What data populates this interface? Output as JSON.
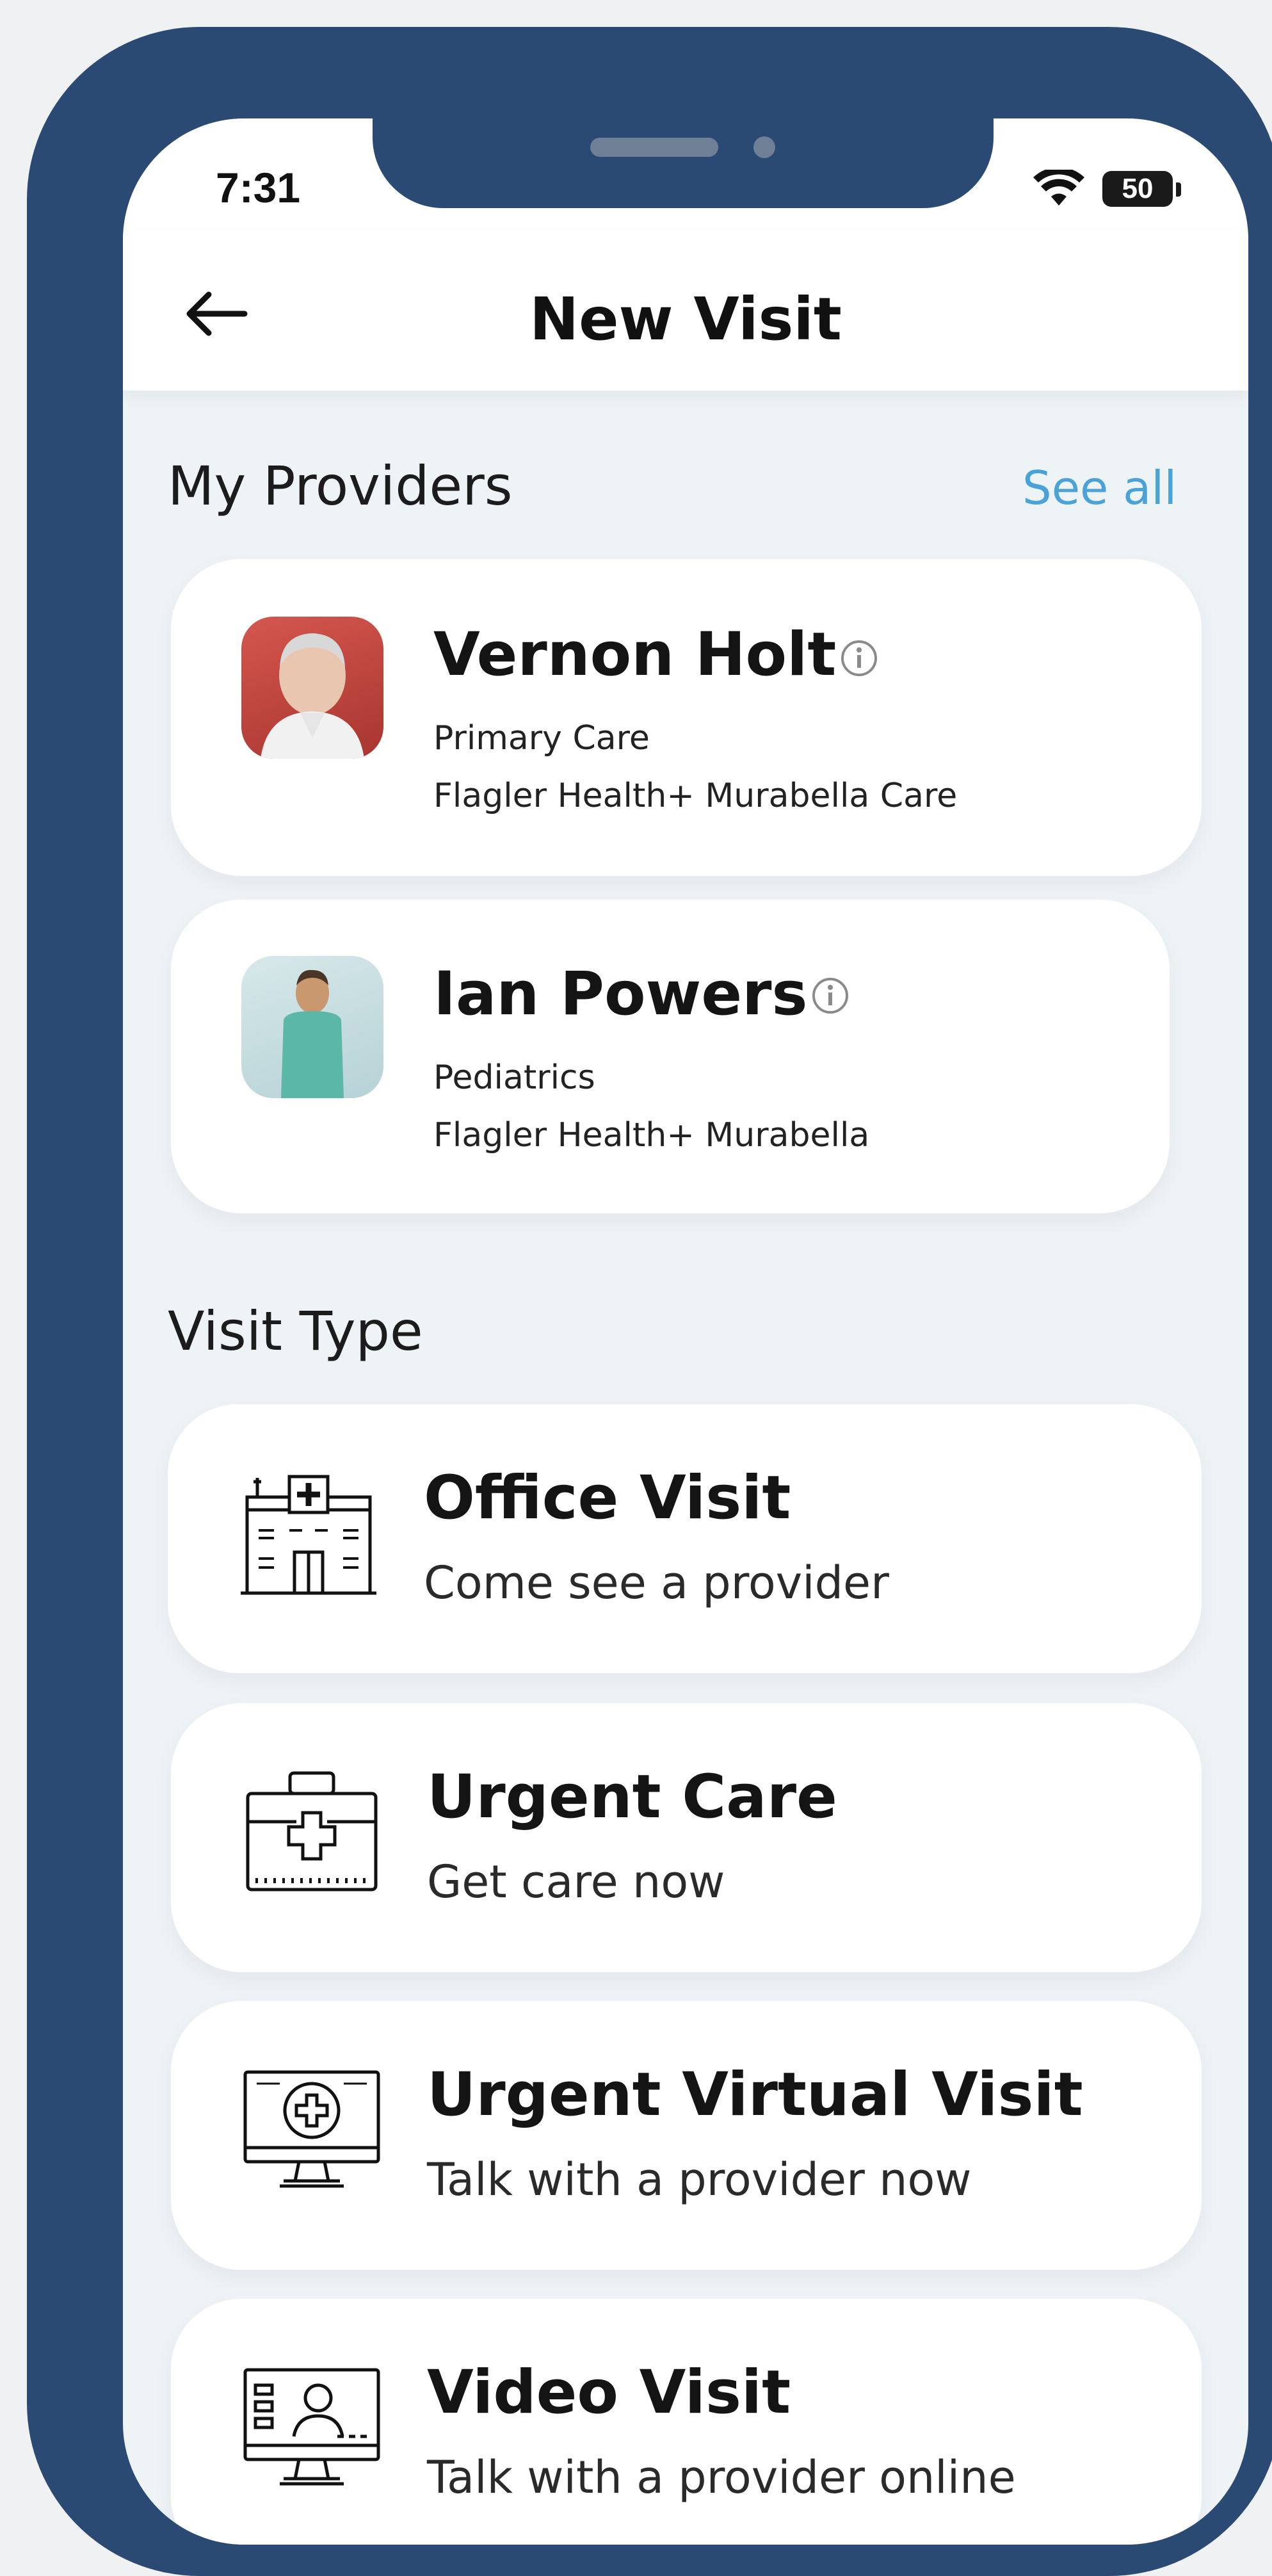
{
  "status_bar": {
    "time": "7:31",
    "battery_level": "50",
    "icons": [
      "wifi-icon",
      "battery-icon"
    ]
  },
  "header": {
    "title": "New Visit",
    "back_icon": "arrow-left-icon"
  },
  "providers_section": {
    "title": "My Providers",
    "see_all": "See all",
    "providers": [
      {
        "name": "Vernon Holt",
        "specialty": "Primary Care",
        "location": "Flagler Health+ Murabella Care",
        "avatar_color": "#c9463f"
      },
      {
        "name": "Ian Powers",
        "specialty": "Pediatrics",
        "location": "Flagler Health+ Murabella",
        "avatar_color": "#bfd9db"
      }
    ]
  },
  "visit_type_section": {
    "title": "Visit Type",
    "types": [
      {
        "title": "Office Visit",
        "subtitle": "Come see a provider",
        "icon": "hospital-building-icon"
      },
      {
        "title": "Urgent Care",
        "subtitle": "Get care now",
        "icon": "first-aid-kit-icon"
      },
      {
        "title": "Urgent Virtual Visit",
        "subtitle": "Talk with a provider now",
        "icon": "monitor-medical-icon"
      },
      {
        "title": "Video Visit",
        "subtitle": "Talk with a provider online",
        "icon": "video-call-monitor-icon"
      }
    ]
  },
  "colors": {
    "frame": "#2a4a74",
    "background": "#eef3f6",
    "accent": "#4aa3d8"
  }
}
